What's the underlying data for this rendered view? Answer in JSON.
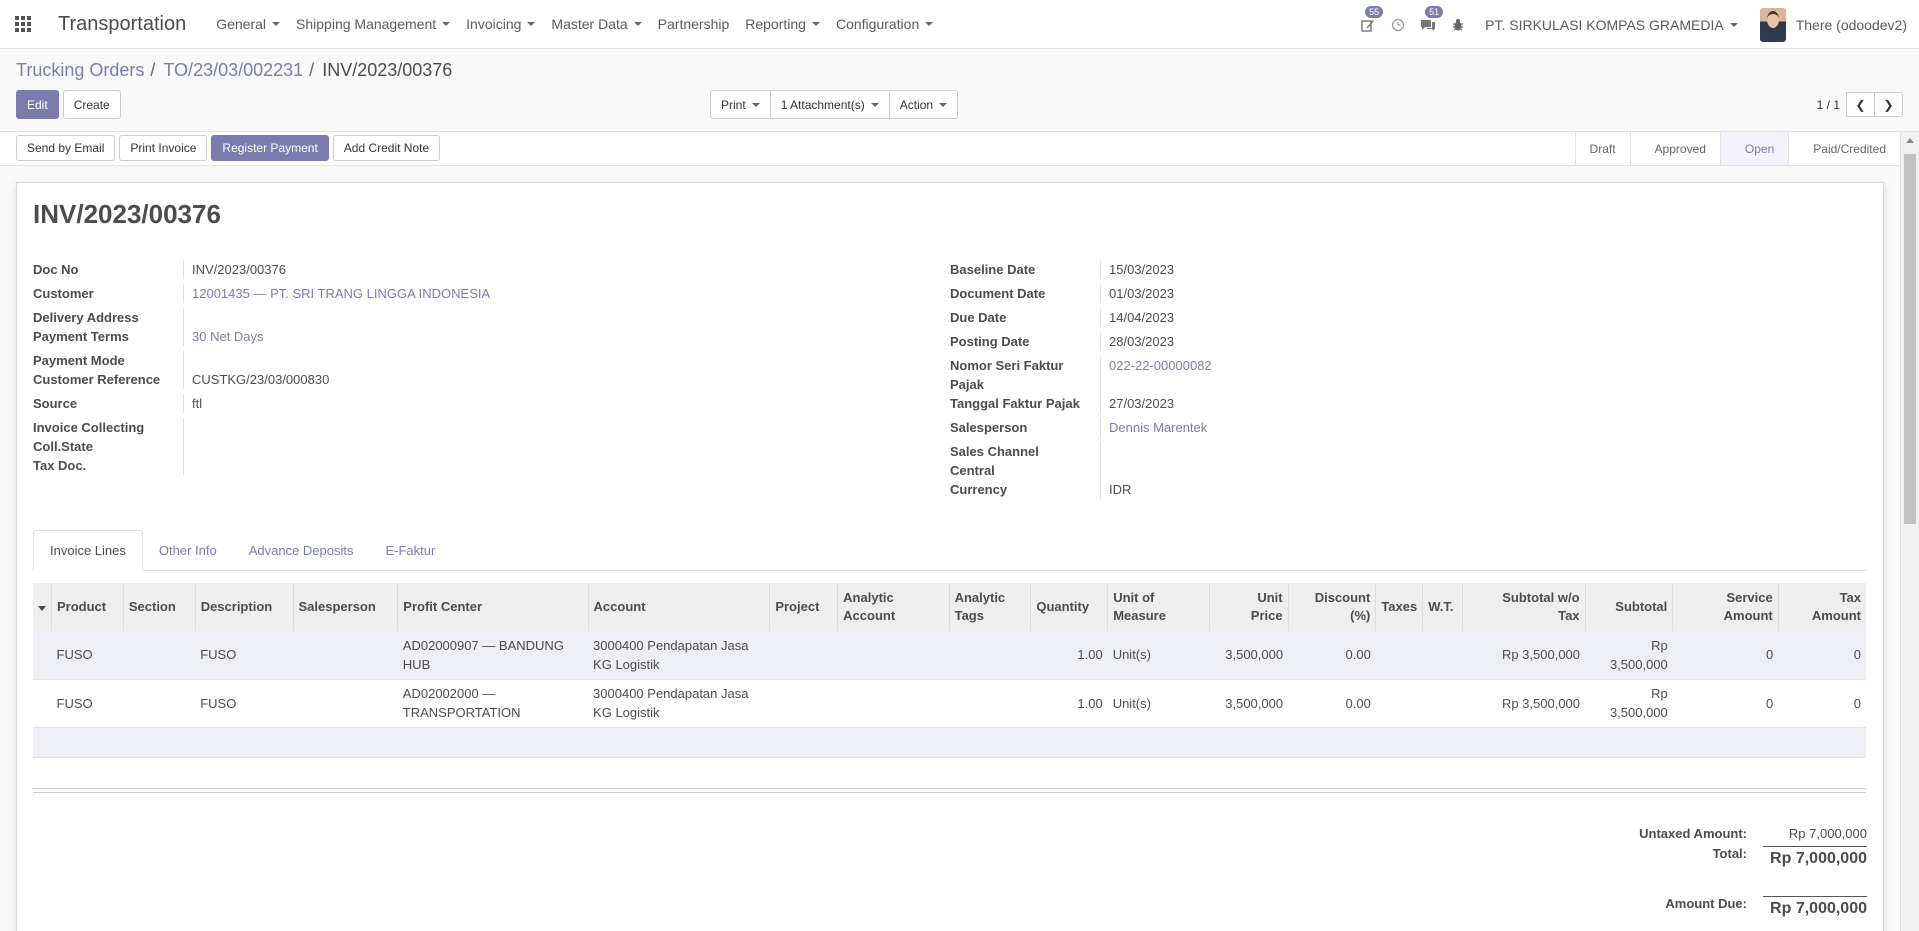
{
  "app": {
    "title": "Transportation"
  },
  "menu": [
    {
      "label": "General",
      "dropdown": true
    },
    {
      "label": "Shipping Management",
      "dropdown": true
    },
    {
      "label": "Invoicing",
      "dropdown": true
    },
    {
      "label": "Master Data",
      "dropdown": true
    },
    {
      "label": "Partnership",
      "dropdown": false
    },
    {
      "label": "Reporting",
      "dropdown": true
    },
    {
      "label": "Configuration",
      "dropdown": true
    }
  ],
  "systray": {
    "activity_count": "55",
    "messages_count": "51",
    "company": "PT. SIRKULASI KOMPAS GRAMEDIA",
    "user": "There (odoodev2)"
  },
  "breadcrumb": {
    "items": [
      "Trucking Orders",
      "TO/23/03/002231"
    ],
    "current": "INV/2023/00376"
  },
  "control": {
    "edit": "Edit",
    "create": "Create",
    "print": "Print",
    "attachments": "1 Attachment(s)",
    "action": "Action",
    "pager": "1 / 1"
  },
  "header_buttons": {
    "send_email": "Send by Email",
    "print_invoice": "Print Invoice",
    "register_payment": "Register Payment",
    "add_credit_note": "Add Credit Note"
  },
  "statusbar": [
    "Draft",
    "Approved",
    "Open",
    "Paid/Credited"
  ],
  "statusbar_active": "Open",
  "form": {
    "title": "INV/2023/00376",
    "left": {
      "doc_no_label": "Doc No",
      "doc_no": "INV/2023/00376",
      "customer_label": "Customer",
      "customer": "12001435 — PT. SRI TRANG LINGGA INDONESIA",
      "delivery_label": "Delivery Address",
      "payment_terms_label": "Payment Terms",
      "payment_terms": "30 Net Days",
      "payment_mode_label": "Payment Mode",
      "customer_ref_label": "Customer Reference",
      "customer_ref": "CUSTKG/23/03/000830",
      "source_label": "Source",
      "source": "ftl",
      "inv_collecting_label": "Invoice Collecting",
      "coll_state_label": "Coll.State",
      "tax_doc_label": "Tax Doc."
    },
    "right": {
      "baseline_label": "Baseline Date",
      "baseline": "15/03/2023",
      "document_date_label": "Document Date",
      "document_date": "01/03/2023",
      "due_date_label": "Due Date",
      "due_date": "14/04/2023",
      "posting_date_label": "Posting Date",
      "posting_date": "28/03/2023",
      "nomor_seri_label_1": "Nomor Seri Faktur",
      "nomor_seri_label_2": "Pajak",
      "nomor_seri": "022-22-00000082",
      "tanggal_faktur_label": "Tanggal Faktur Pajak",
      "tanggal_faktur": "27/03/2023",
      "salesperson_label": "Salesperson",
      "salesperson": "Dennis Marentek",
      "sales_channel_label_1": "Sales Channel",
      "sales_channel_label_2": "Central",
      "currency_label": "Currency",
      "currency": "IDR"
    }
  },
  "tabs": [
    "Invoice Lines",
    "Other Info",
    "Advance Deposits",
    "E-Faktur"
  ],
  "table": {
    "headers": {
      "product": "Product",
      "section": "Section",
      "description": "Description",
      "salesperson": "Salesperson",
      "profit_center": "Profit Center",
      "account": "Account",
      "project": "Project",
      "analytic_account_1": "Analytic",
      "analytic_account_2": "Account",
      "analytic_tags_1": "Analytic",
      "analytic_tags_2": "Tags",
      "quantity": "Quantity",
      "uom_1": "Unit of",
      "uom_2": "Measure",
      "unit_price_1": "Unit",
      "unit_price_2": "Price",
      "discount_1": "Discount",
      "discount_2": "(%)",
      "taxes": "Taxes",
      "wt": "W.T.",
      "subtotal_wo_1": "Subtotal w/o",
      "subtotal_wo_2": "Tax",
      "subtotal": "Subtotal",
      "service_1": "Service",
      "service_2": "Amount",
      "tax_amount_1": "Tax",
      "tax_amount_2": "Amount"
    },
    "rows": [
      {
        "product": "FUSO",
        "section": "",
        "description": "FUSO",
        "salesperson": "",
        "profit_center_1": "AD02000907 — BANDUNG",
        "profit_center_2": "HUB",
        "account_1": "3000400 Pendapatan Jasa",
        "account_2": "KG Logistik",
        "project": "",
        "analytic_account": "",
        "analytic_tags": "",
        "quantity": "1.00",
        "uom": "Unit(s)",
        "unit_price": "3,500,000",
        "discount": "0.00",
        "taxes": "",
        "wt": "",
        "subtotal_wo": "Rp 3,500,000",
        "subtotal": "Rp 3,500,000",
        "service": "0",
        "tax_amount": "0"
      },
      {
        "product": "FUSO",
        "section": "",
        "description": "FUSO",
        "salesperson": "",
        "profit_center_1": "AD02002000 —",
        "profit_center_2": "TRANSPORTATION",
        "account_1": "3000400 Pendapatan Jasa",
        "account_2": "KG Logistik",
        "project": "",
        "analytic_account": "",
        "analytic_tags": "",
        "quantity": "1.00",
        "uom": "Unit(s)",
        "unit_price": "3,500,000",
        "discount": "0.00",
        "taxes": "",
        "wt": "",
        "subtotal_wo": "Rp 3,500,000",
        "subtotal": "Rp 3,500,000",
        "service": "0",
        "tax_amount": "0"
      }
    ]
  },
  "totals": {
    "untaxed_label": "Untaxed Amount:",
    "untaxed": "Rp 7,000,000",
    "total_label": "Total:",
    "total": "Rp 7,000,000",
    "amount_due_label": "Amount Due:",
    "amount_due": "Rp 7,000,000"
  },
  "colors": {
    "brand": "#7c7bad",
    "text": "#4c4c4c",
    "row_highlight": "#eeeef5"
  },
  "icons": [
    "apps-grid-icon",
    "edit-activity-icon",
    "clock-icon",
    "chat-icon",
    "bug-icon",
    "chevron-left-icon",
    "chevron-right-icon"
  ]
}
